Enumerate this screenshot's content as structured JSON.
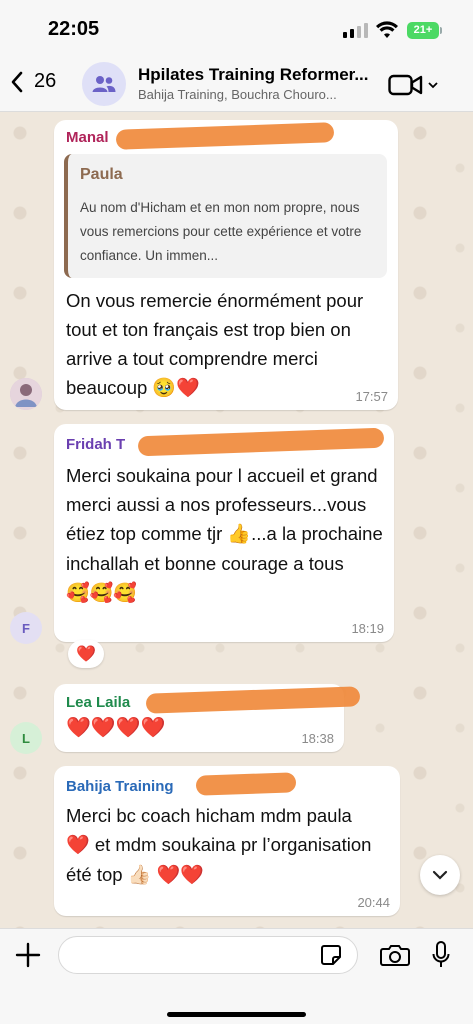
{
  "status": {
    "time": "22:05",
    "battery": "21+"
  },
  "header": {
    "back_count": "26",
    "title": "Hpilates Training Reformer...",
    "subtitle": "Bahija Training, Bouchra Chouro..."
  },
  "messages": [
    {
      "sender": "Manal",
      "sender_color": "#b0245a",
      "quote_name": "Paula",
      "quote_text": "Au nom d'Hicham et en mon nom propre, nous vous remercions pour cette expérience et votre confiance. Un immen...",
      "text": "On vous remercie énormément pour tout et ton français est trop bien on arrive a tout comprendre merci beaucoup",
      "emoji": "🥹❤️",
      "time": "17:57"
    },
    {
      "sender": "Fridah T",
      "sender_color": "#6a3fb0",
      "avatar_letter": "F",
      "text": "Merci soukaina pour l accueil et grand merci aussi a nos professeurs...vous étiez top comme tjr",
      "text2": "...a la prochaine inchallah et bonne courage a tous",
      "emoji_inline": "👍",
      "emoji_end": "🥰🥰🥰",
      "time": "18:19",
      "reaction": "❤️"
    },
    {
      "sender": "Lea Laila",
      "sender_color": "#1f8a4c",
      "avatar_letter": "L",
      "text": "❤️❤️❤️❤️",
      "time": "18:38"
    },
    {
      "sender": "Bahija Training",
      "sender_color": "#2a6ab8",
      "text": "Merci bc coach hicham mdm paula",
      "text2": "et mdm soukaina pr l’organisation été top",
      "emoji_a": "❤️",
      "emoji_b": "👍🏻 ❤️❤️",
      "time": "20:44"
    }
  ]
}
